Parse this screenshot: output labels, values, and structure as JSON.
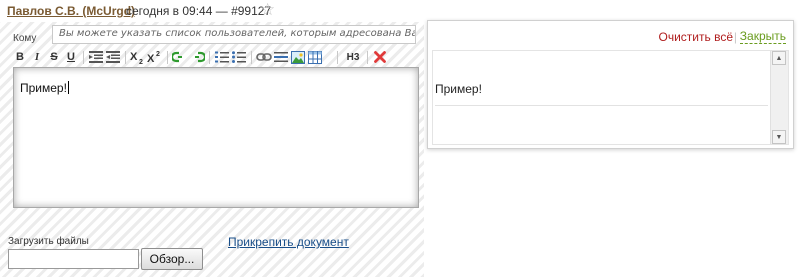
{
  "comment": {
    "author": "Павлов С.В. (McUrgd)",
    "meta": "сегодня в 09:44 — #99127"
  },
  "recipients": {
    "label": "Кому",
    "placeholder": "Вы можете указать список пользователей, которым адресована Ваша запись"
  },
  "toolbar": {
    "bold": "B",
    "italic": "I",
    "strike": "S",
    "underline": "U",
    "heading": "H3"
  },
  "editor": {
    "text": "Пример!"
  },
  "upload": {
    "label": "Загрузить файлы",
    "browse_label": "Обзор...",
    "attach_label": "Прикрепить документ"
  },
  "preview": {
    "clear_label": "Очистить всё",
    "separator": "|",
    "close_label": "Закрыть",
    "text": "Пример!"
  },
  "colors": {
    "author": "#7a5a32",
    "link": "#1a4f8a",
    "clear": "#b01e1e",
    "close": "#6a9c1f",
    "delete_icon": "#e03a3a"
  }
}
